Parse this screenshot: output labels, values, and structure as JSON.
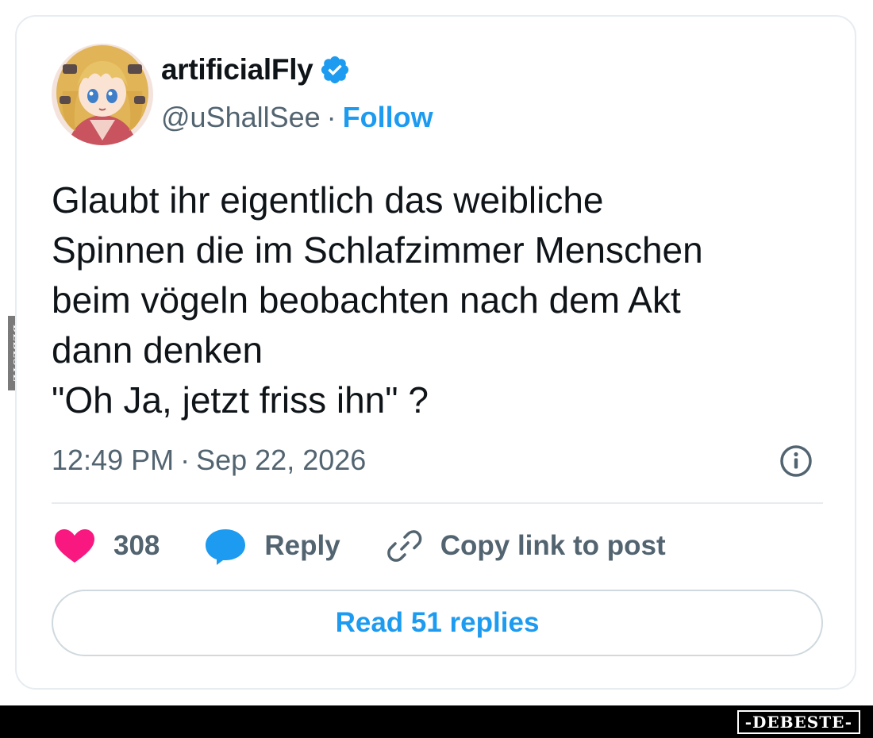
{
  "tweet": {
    "author": {
      "display_name": "artificialFly",
      "handle": "@uShallSee",
      "separator": "·",
      "follow_label": "Follow",
      "verified_icon": "verified-badge-icon",
      "avatar_icon": "anime-avatar"
    },
    "text_lines": [
      "Glaubt ihr eigentlich das weibliche",
      "Spinnen die im Schlafzimmer Menschen",
      "beim vögeln beobachten nach dem Akt",
      "dann denken",
      "\"Oh Ja, jetzt friss ihn\" ?"
    ],
    "timestamp": {
      "time": "12:49 PM",
      "separator": "·",
      "date": "Sep 22, 2026"
    },
    "actions": {
      "likes_count": "308",
      "reply_label": "Reply",
      "copy_link_label": "Copy link to post"
    },
    "read_replies_label": "Read 51 replies"
  },
  "colors": {
    "accent": "#1d9bf0",
    "text": "#0f1419",
    "muted": "#536471",
    "heart": "#f91880",
    "border": "#e6ecf0"
  },
  "watermark": {
    "side_text": "DEBESTE",
    "footer_text": "-DEBESTE-"
  }
}
